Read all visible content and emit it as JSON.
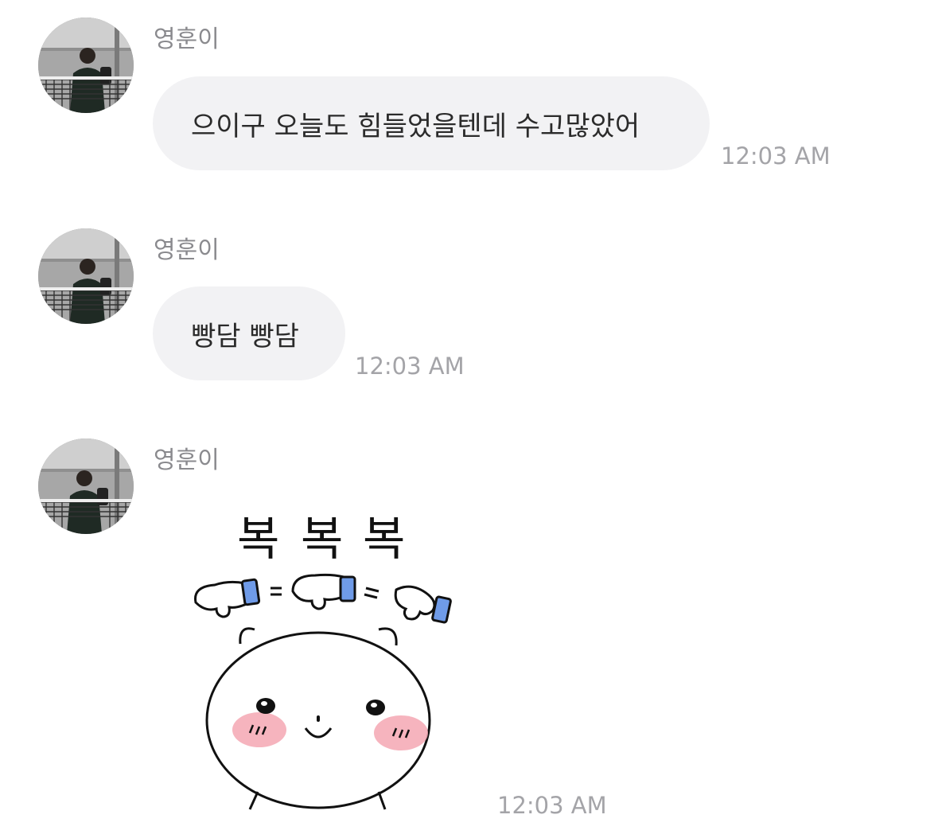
{
  "messages": [
    {
      "sender": "영훈이",
      "text": "으이구 오늘도 힘들었을텐데 수고많았어",
      "time": "12:03 AM"
    },
    {
      "sender": "영훈이",
      "text": "빵담 빵담",
      "time": "12:03 AM"
    },
    {
      "sender": "영훈이",
      "sticker": {
        "caption": "복 복 복",
        "syllables": [
          "복",
          "복",
          "복"
        ],
        "description": "white bear sticker patting head"
      },
      "time": "12:03 AM"
    }
  ],
  "colors": {
    "bubble_background": "#f2f2f4",
    "name_text": "#8a8a8e",
    "time_text": "#a4a4a8",
    "message_text": "#2b2b2b",
    "sticker_cuff": "#6f9be8",
    "sticker_blush": "#f4a7b3"
  },
  "icons": {
    "avatar": "profile-photo"
  }
}
